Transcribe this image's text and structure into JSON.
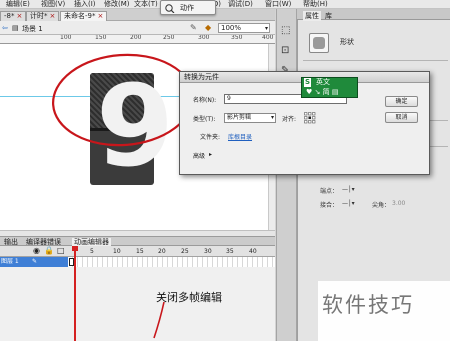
{
  "menu": {
    "items": [
      "编辑(E)",
      "视图(V)",
      "插入(I)",
      "修改(M)",
      "文本(T)",
      "控制(O)",
      "调试(D)",
      "窗口(W)",
      "帮助(H)"
    ]
  },
  "doc_tabs": [
    {
      "label": "-8*",
      "close": "×"
    },
    {
      "label": "计时*",
      "close": "×"
    },
    {
      "label": "未命名-9*",
      "close": "×"
    }
  ],
  "floating_button": {
    "label": "动作"
  },
  "scene": {
    "label": "场景 1",
    "zoom": "100%"
  },
  "ruler": {
    "ticks": [
      "100",
      "150",
      "200",
      "250",
      "300",
      "350",
      "400"
    ]
  },
  "right_panel": {
    "tabs": [
      "属性",
      "库"
    ],
    "item_type": "形状",
    "rows": [
      {
        "label": "端点：",
        "value": "—│▾"
      },
      {
        "label": "接合：",
        "value": "—│▾"
      },
      {
        "label": "尖角：",
        "value": "3.00"
      }
    ]
  },
  "dialog": {
    "title": "转换为元件",
    "name_label": "名称(N):",
    "name_value": "9",
    "type_label": "类型(T):",
    "type_value": "影片剪辑",
    "align_label": "对齐:",
    "folder_label": "文件夹:",
    "folder_value": "库根目录",
    "advanced_label": "高级",
    "ok_label": "确定",
    "cancel_label": "取消"
  },
  "ime": {
    "lang": "英文",
    "icons": "♥ ↘ 简 ▤",
    "logo": "S"
  },
  "timeline": {
    "tabs": [
      "输出",
      "编译器错误",
      "动画编辑器"
    ],
    "frame_numbers": [
      "5",
      "10",
      "15",
      "20",
      "25",
      "30",
      "35",
      "40"
    ],
    "layer_name": "图层 1"
  },
  "annotation": "关闭多帧编辑",
  "watermark": "软件技巧",
  "stage_graphic": {
    "digit": "9"
  },
  "colors": {
    "ime_green": "#1f8a3b",
    "annotation_red": "#c8161b",
    "playhead_red": "#d42020",
    "link_blue": "#1f5fbf",
    "digit_tile": "#3b3b3b"
  }
}
